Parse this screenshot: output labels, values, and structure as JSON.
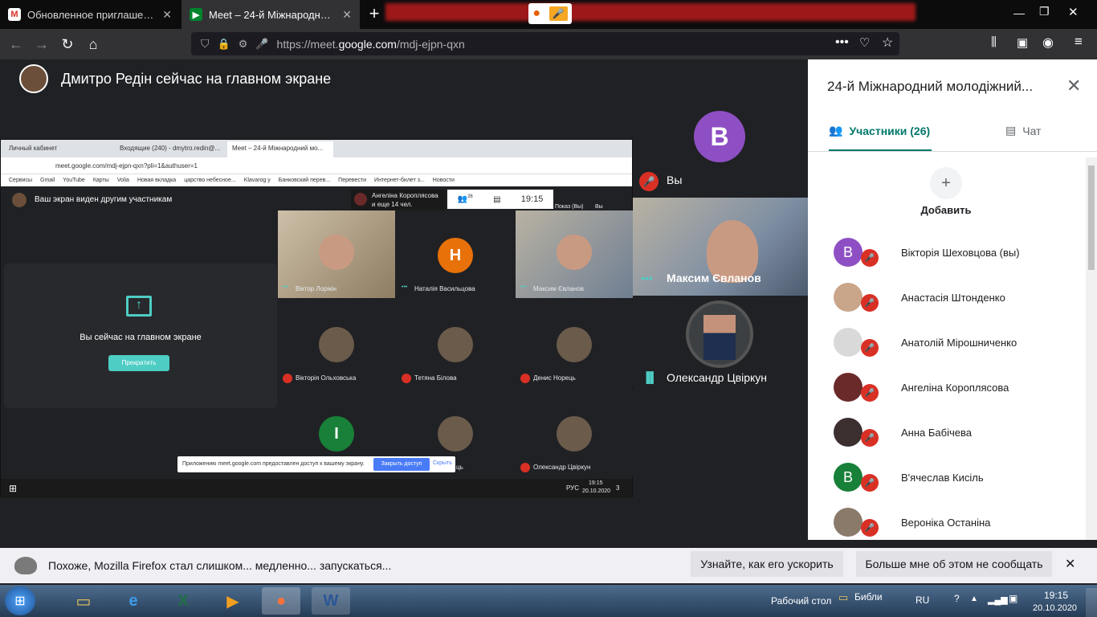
{
  "browser": {
    "tabs": [
      {
        "title": "Обновленное приглашение: 24...",
        "icon": "gmail-icon"
      },
      {
        "title": "Meet – 24-й Міжнародний мо...",
        "icon": "meet-icon"
      }
    ],
    "new_tab": "+",
    "url_prefix": "https://meet.",
    "url_domain": "google.com",
    "url_path": "/mdj-ejpn-qxn"
  },
  "meet": {
    "presenter_title": "Дмитро Редін сейчас на главном экране",
    "tiles": [
      {
        "name": "Вы",
        "initial": "В",
        "color": "#8e4fc4"
      },
      {
        "name": "Максим Євланов"
      },
      {
        "name": "Олександр Цвіркун"
      }
    ]
  },
  "shared_screen": {
    "tabs": [
      "Личный кабинет",
      "Входящие (240) - dmytro.redin@...",
      "Meet – 24-й Міжнародний мо..."
    ],
    "url": "meet.google.com/mdj-ejpn-qxn?pli=1&authuser=1",
    "bookmarks": [
      "Сервисы",
      "Gmail",
      "YouTube",
      "Карты",
      "Volia",
      "Новая вкладка",
      "царство небесное...",
      "Klavarog у",
      "Банковский перев...",
      "Перевести",
      "Интернет-билет з...",
      "Новости"
    ],
    "banner": "Ваш экран виден другим участникам",
    "viewer": "Ангеліна Короплясова",
    "viewer_more": "и еще 14 чел.",
    "count": "26",
    "time": "19:15",
    "presenting_label": "Показ (Вы)",
    "you_label": "Вы",
    "main_screen_text": "Вы сейчас на главном экране",
    "stop_btn": "Прекратить",
    "grid": [
      {
        "name": "Віктор Лорікін",
        "initial": ""
      },
      {
        "name": "Наталія Васильцова",
        "initial": "Н",
        "color": "#e8710a"
      },
      {
        "name": "Максим Євланов",
        "initial": ""
      },
      {
        "name": "Вікторія Ольховська",
        "initial": ""
      },
      {
        "name": "Тетяна Білова",
        "initial": ""
      },
      {
        "name": "Денис Норець",
        "initial": ""
      },
      {
        "name": "",
        "initial": "І",
        "color": "#188038"
      },
      {
        "name": "",
        "initial": ""
      },
      {
        "name": "Олександр Цвіркун",
        "initial": ""
      }
    ],
    "partial_name": "ць",
    "share_notice": "Приложению meet.google.com предоставлен доступ к вашему экрану.",
    "close_access": "Закрыть доступ",
    "hide": "Скрыть",
    "lang": "РУС",
    "clock_time": "19:15",
    "clock_date": "20.10.2020",
    "notif_count": "3"
  },
  "sidebar": {
    "title": "24-й Міжнародний молодіжний...",
    "tab_people": "Участники (26)",
    "tab_chat": "Чат",
    "add_label": "Добавить",
    "participants": [
      {
        "name": "Вікторія Шеховцова (вы)",
        "initial": "В",
        "color": "#8e4fc4"
      },
      {
        "name": "Анастасія Штонденко",
        "initial": "",
        "color": "#c9a58a"
      },
      {
        "name": "Анатолій Мірошниченко",
        "initial": "",
        "color": "#d9d9d9"
      },
      {
        "name": "Ангеліна Короплясова",
        "initial": "",
        "color": "#6a2a2a"
      },
      {
        "name": "Анна Бабічева",
        "initial": "",
        "color": "#3b2f2f"
      },
      {
        "name": "В'ячеслав Кисіль",
        "initial": "В",
        "color": "#188038"
      },
      {
        "name": "Вероніка Останіна",
        "initial": "",
        "color": "#8a7a6a"
      }
    ]
  },
  "notification": {
    "text": "Похоже, Mozilla Firefox стал слишком... медленно... запускаться...",
    "btn1": "Узнайте, как его ускорить",
    "btn2": "Больше мне об этом не сообщать"
  },
  "taskbar": {
    "desktop_label": "Рабочий стол",
    "lib_label": "Библи",
    "lang": "RU",
    "time": "19:15",
    "date": "20.10.2020"
  }
}
